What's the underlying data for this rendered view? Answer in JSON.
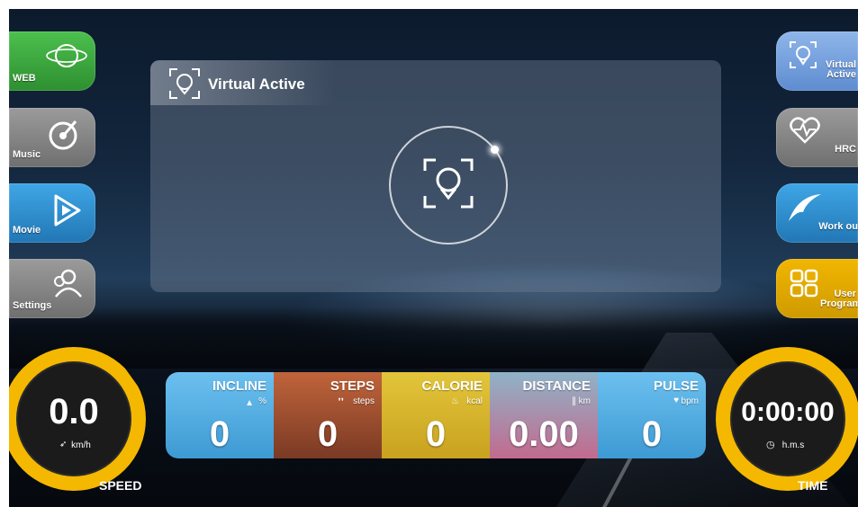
{
  "colors": {
    "web": "#3aa33d",
    "music": "#8a8a8a",
    "movie": "#2d95d6",
    "settings": "#8a8a8a",
    "virtual_active": "#7aa3de",
    "hrc": "#8a8a8a",
    "workout": "#2d95d6",
    "user_program": "#e3a800",
    "gauge": "#f5b800",
    "incline": "#5ab2e6",
    "pulse": "#5ab2e6"
  },
  "left_menu": [
    {
      "label": "WEB",
      "icon": "globe-icon"
    },
    {
      "label": "Music",
      "icon": "music-disc-icon"
    },
    {
      "label": "Movie",
      "icon": "play-film-icon"
    },
    {
      "label": "Settings",
      "icon": "users-settings-icon"
    }
  ],
  "right_menu": [
    {
      "label": "Virtual Active",
      "icon": "virtual-camera-icon"
    },
    {
      "label": "HRC",
      "icon": "heart-pulse-icon"
    },
    {
      "label": "Work ou",
      "icon": "runner-swoosh-icon"
    },
    {
      "label": "User Program",
      "icon": "grid-program-icon"
    }
  ],
  "panel": {
    "title": "Virtual Active",
    "center_icon": "virtual-location-icon"
  },
  "speed": {
    "value": "0.0",
    "unit": "km/h",
    "label": "SPEED"
  },
  "time": {
    "value": "0:00:00",
    "unit": "h.m.s",
    "label": "TIME"
  },
  "stats": [
    {
      "title": "INCLINE",
      "unit": "%",
      "value": "0"
    },
    {
      "title": "STEPS",
      "unit": "steps",
      "value": "0"
    },
    {
      "title": "CALORIE",
      "unit": "kcal",
      "value": "0"
    },
    {
      "title": "DISTANCE",
      "unit": "km",
      "value": "0.00"
    },
    {
      "title": "PULSE",
      "unit": "bpm",
      "value": "0"
    }
  ]
}
